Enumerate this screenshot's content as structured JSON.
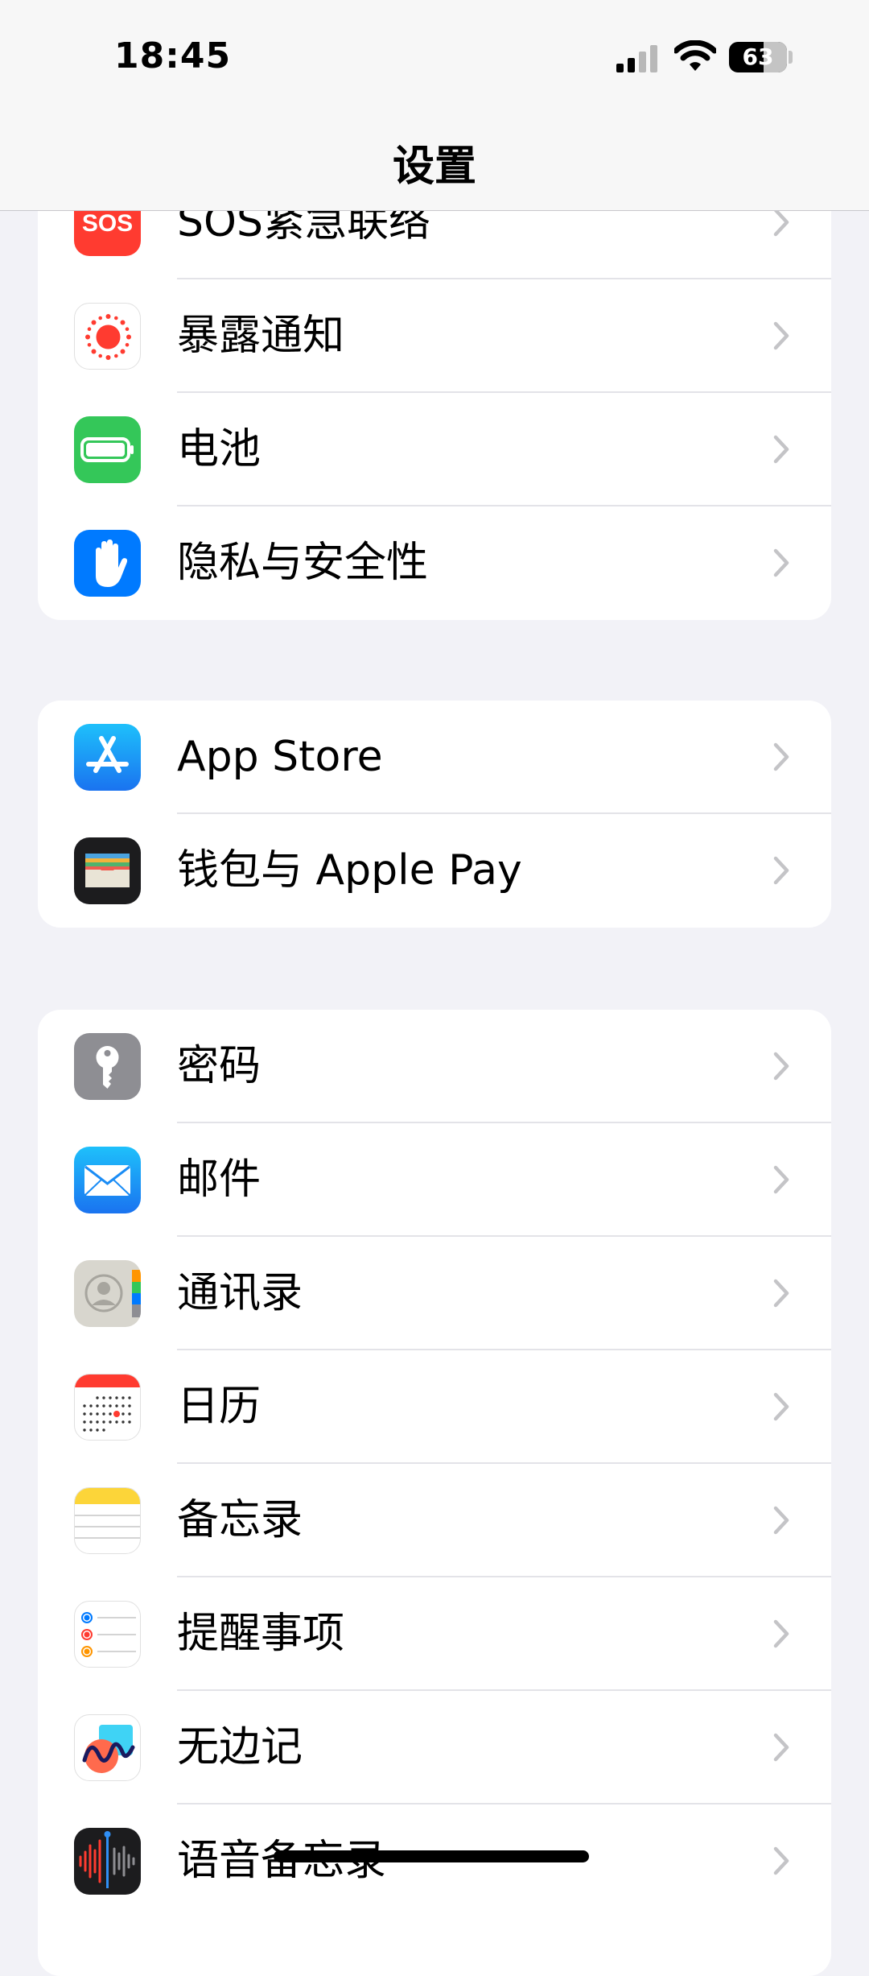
{
  "status_bar": {
    "time": "18:45",
    "battery_percent": "63"
  },
  "nav": {
    "title": "设置"
  },
  "groups": [
    {
      "items": [
        {
          "label": "SOS紧急联络",
          "icon": "sos-icon",
          "icon_text": "SOS",
          "icon_color": "#ff3b30"
        },
        {
          "label": "暴露通知",
          "icon": "exposure-notification-icon",
          "icon_color": "#ffffff"
        },
        {
          "label": "电池",
          "icon": "battery-icon",
          "icon_color": "#34c759"
        },
        {
          "label": "隐私与安全性",
          "icon": "hand-icon",
          "icon_color": "#007aff"
        }
      ]
    },
    {
      "items": [
        {
          "label": "App Store",
          "icon": "app-store-icon",
          "icon_color": "#1c8ef9"
        },
        {
          "label": "钱包与 Apple Pay",
          "icon": "wallet-icon",
          "icon_color": "#1c1c1e"
        }
      ]
    },
    {
      "items": [
        {
          "label": "密码",
          "icon": "key-icon",
          "icon_color": "#8e8e93"
        },
        {
          "label": "邮件",
          "icon": "mail-icon",
          "icon_color": "#1a8cf5"
        },
        {
          "label": "通讯录",
          "icon": "contacts-icon",
          "icon_color": "#d8d6ce"
        },
        {
          "label": "日历",
          "icon": "calendar-icon",
          "icon_color": "#ffffff"
        },
        {
          "label": "备忘录",
          "icon": "notes-icon",
          "icon_color": "#ffffff"
        },
        {
          "label": "提醒事项",
          "icon": "reminders-icon",
          "icon_color": "#ffffff"
        },
        {
          "label": "无边记",
          "icon": "freeform-icon",
          "icon_color": "#ffffff"
        },
        {
          "label": "语音备忘录",
          "icon": "voice-memos-icon",
          "icon_color": "#1c1c1e"
        }
      ]
    }
  ]
}
